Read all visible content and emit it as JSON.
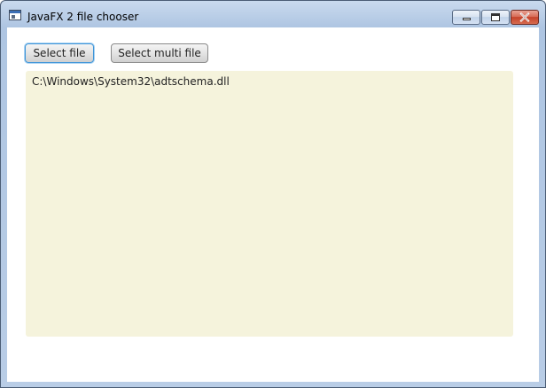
{
  "window": {
    "title": "JavaFX 2 file chooser",
    "icons": {
      "app": "application-icon",
      "minimize": "minimize-icon",
      "maximize": "maximize-icon",
      "close": "close-icon"
    },
    "colors": {
      "close_button": "#c5422a",
      "focus_ring": "#3f95d8"
    }
  },
  "toolbar": {
    "select_file_label": "Select file",
    "select_multi_file_label": "Select multi file"
  },
  "output": {
    "text": "C:\\Windows\\System32\\adtschema.dll",
    "background": "#f5f3dc"
  }
}
